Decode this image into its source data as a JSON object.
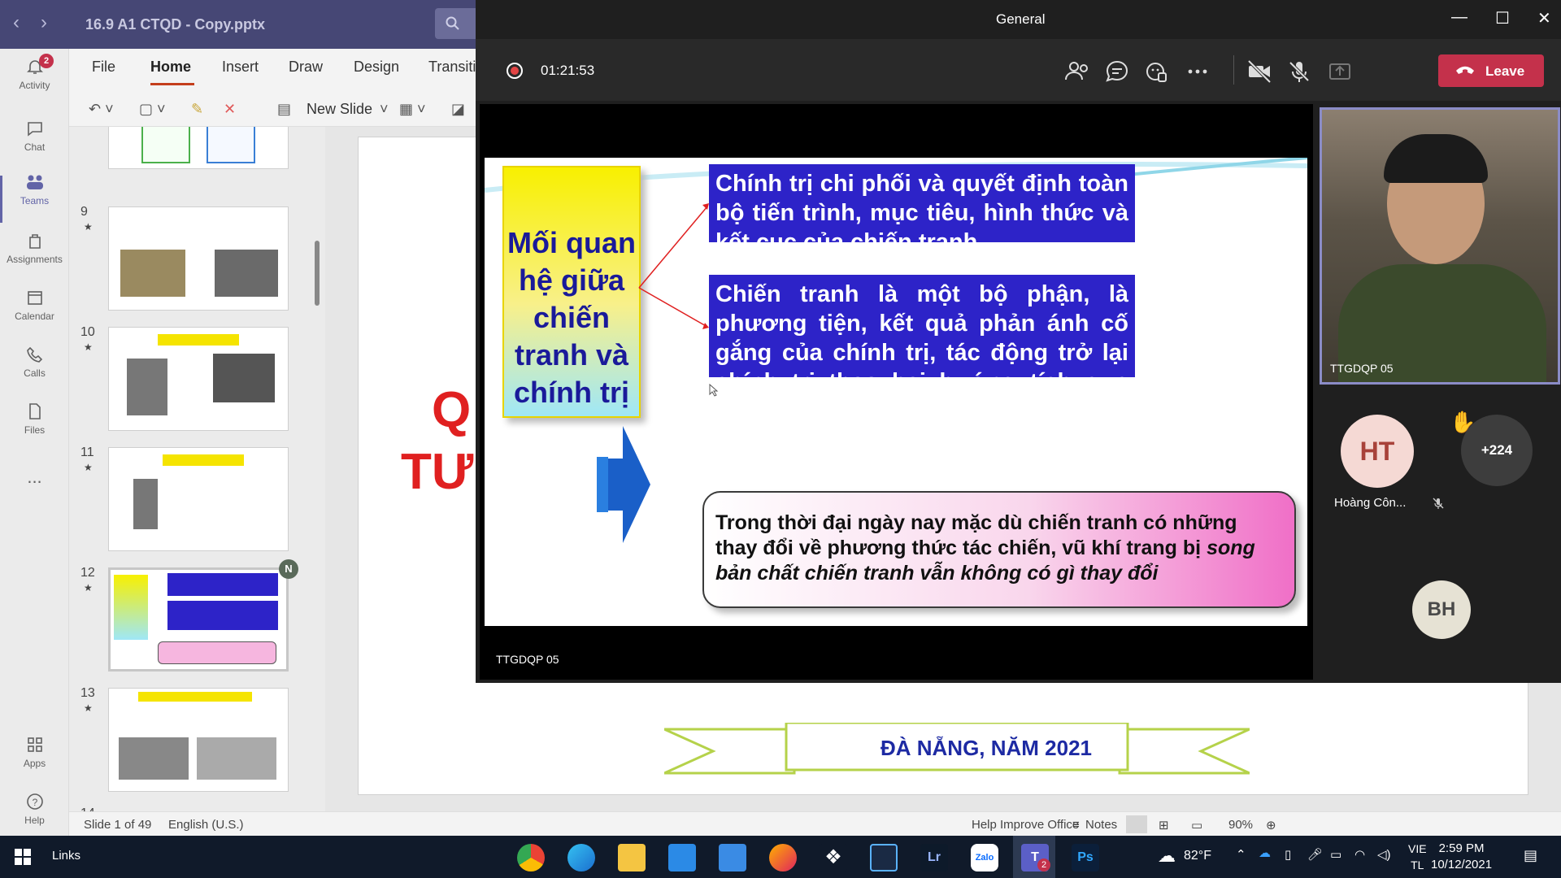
{
  "teams_rail": {
    "items": [
      {
        "label": "Activity",
        "badge": "2"
      },
      {
        "label": "Chat"
      },
      {
        "label": "Teams"
      },
      {
        "label": "Assignments"
      },
      {
        "label": "Calendar"
      },
      {
        "label": "Calls"
      },
      {
        "label": "Files"
      },
      {
        "label": "..."
      },
      {
        "label": "Apps"
      },
      {
        "label": "Help"
      }
    ]
  },
  "ppt": {
    "file_title": "16.9 A1 CTQD - Copy.pptx",
    "tabs": [
      "File",
      "Home",
      "Insert",
      "Draw",
      "Design",
      "Transiti"
    ],
    "new_slide_label": "New Slide",
    "thumbnails": [
      {
        "num": "9",
        "star": "★"
      },
      {
        "num": "10",
        "star": "★"
      },
      {
        "num": "11",
        "star": "★"
      },
      {
        "num": "12",
        "star": "★"
      },
      {
        "num": "13",
        "star": "★"
      },
      {
        "num": "14",
        "star": ""
      }
    ],
    "slide12_badge": "N",
    "main_slide": {
      "line1": "Q",
      "line2": "TƯ",
      "footer": "ĐÀ NẴNG, NĂM 2021"
    },
    "status": {
      "slide": "Slide 1 of 49",
      "lang": "English (U.S.)",
      "help": "Help Improve Office",
      "notes": "Notes",
      "zoom": "90%"
    }
  },
  "meeting": {
    "title": "General",
    "timer": "01:21:53",
    "leave_label": "Leave",
    "presenter_label": "TTGDQP 05",
    "shared_slide": {
      "left_box": "Mối quan hệ giữa chiến tranh và chính trị",
      "top_box": "Chính trị chi phối và quyết định toàn bộ tiến trình, mục tiêu, hình thức và kết cục của chiến tranh...",
      "mid_box": "Chiến tranh là một bộ phận, là phương tiện, kết quả phản ánh cố gắng của chính trị, tác động trở lại chính trị theo hai hướng tích cực hoặc tiêu cực",
      "bottom_box_plain": "Trong thời đại ngày nay mặc dù chiến tranh có những thay đổi về phương thức tác chiến, vũ khí trang bị ",
      "bottom_box_italic": "song bản chất chiến tranh vẫn không có gì thay đổi"
    },
    "camera_label": "TTGDQP 05",
    "participants": [
      {
        "initials": "HT",
        "name": "Hoàng Côn...",
        "color": "#f5d9d4",
        "text_color": "#a8423a"
      },
      {
        "initials": "BH",
        "color": "#e6e2d4",
        "text_color": "#4a4a4a"
      }
    ],
    "more_count": "+224"
  },
  "taskbar": {
    "links": "Links",
    "weather": "82°F",
    "lang_line1": "VIE",
    "lang_line2": "TL",
    "time": "2:59 PM",
    "date": "10/12/2021",
    "teams_badge": "2"
  },
  "colors": {
    "teams_purple": "#464775",
    "accent": "#6264a7",
    "leave_red": "#c4314b",
    "record_red": "#e24444"
  }
}
